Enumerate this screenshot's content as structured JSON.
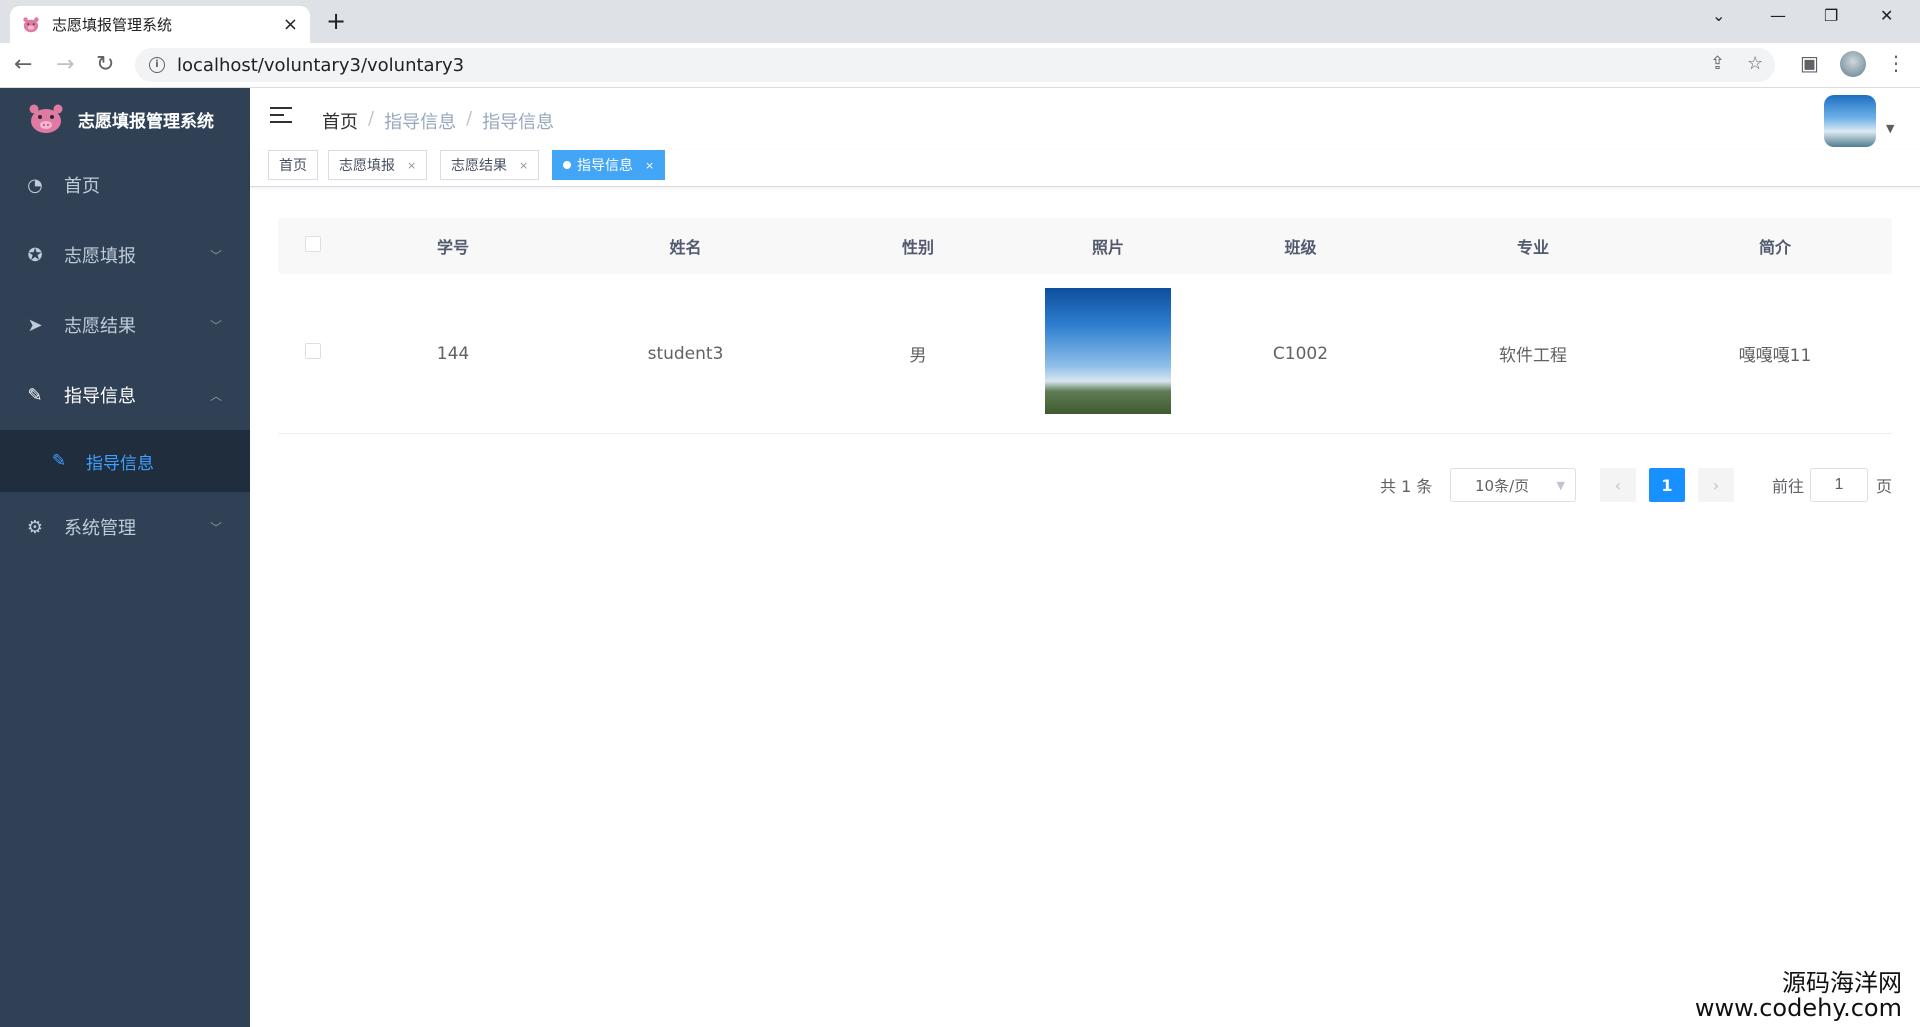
{
  "browser": {
    "tab_title": "志愿填报管理系统",
    "tab_close": "×",
    "new_tab": "+",
    "url": "localhost/voluntary3/voluntary3"
  },
  "sidebar": {
    "brand": "志愿填报管理系统",
    "items": [
      {
        "label": "首页",
        "icon": "dashboard-icon"
      },
      {
        "label": "志愿填报",
        "icon": "lifebuoy-icon"
      },
      {
        "label": "志愿结果",
        "icon": "send-icon"
      },
      {
        "label": "指导信息",
        "icon": "edit-icon"
      },
      {
        "label": "系统管理",
        "icon": "gear-icon"
      }
    ],
    "submenu": {
      "label": "指导信息",
      "icon": "edit-icon"
    }
  },
  "navbar": {
    "breadcrumb": [
      "首页",
      "指导信息",
      "指导信息"
    ],
    "separator": "/"
  },
  "tags": [
    {
      "label": "首页"
    },
    {
      "label": "志愿填报",
      "close": "×"
    },
    {
      "label": "志愿结果",
      "close": "×"
    },
    {
      "label": "指导信息",
      "close": "×"
    }
  ],
  "table": {
    "headers": [
      "学号",
      "姓名",
      "性别",
      "照片",
      "班级",
      "专业",
      "简介"
    ],
    "rows": [
      {
        "student_id": "144",
        "name": "student3",
        "gender": "男",
        "class": "C1002",
        "major": "软件工程",
        "intro": "嘎嘎嘎11"
      }
    ]
  },
  "pagination": {
    "total": "共 1 条",
    "page_size": "10条/页",
    "current_page": "1",
    "goto_label": "前往",
    "goto_value": "1",
    "page_suffix": "页",
    "prev": "‹",
    "next": "›"
  },
  "watermark": {
    "line1": "源码海洋网",
    "line2": "www.codehy.com"
  },
  "colors": {
    "sidebar_bg": "#304156",
    "accent": "#409eff",
    "active_tag": "#42a5f5"
  }
}
